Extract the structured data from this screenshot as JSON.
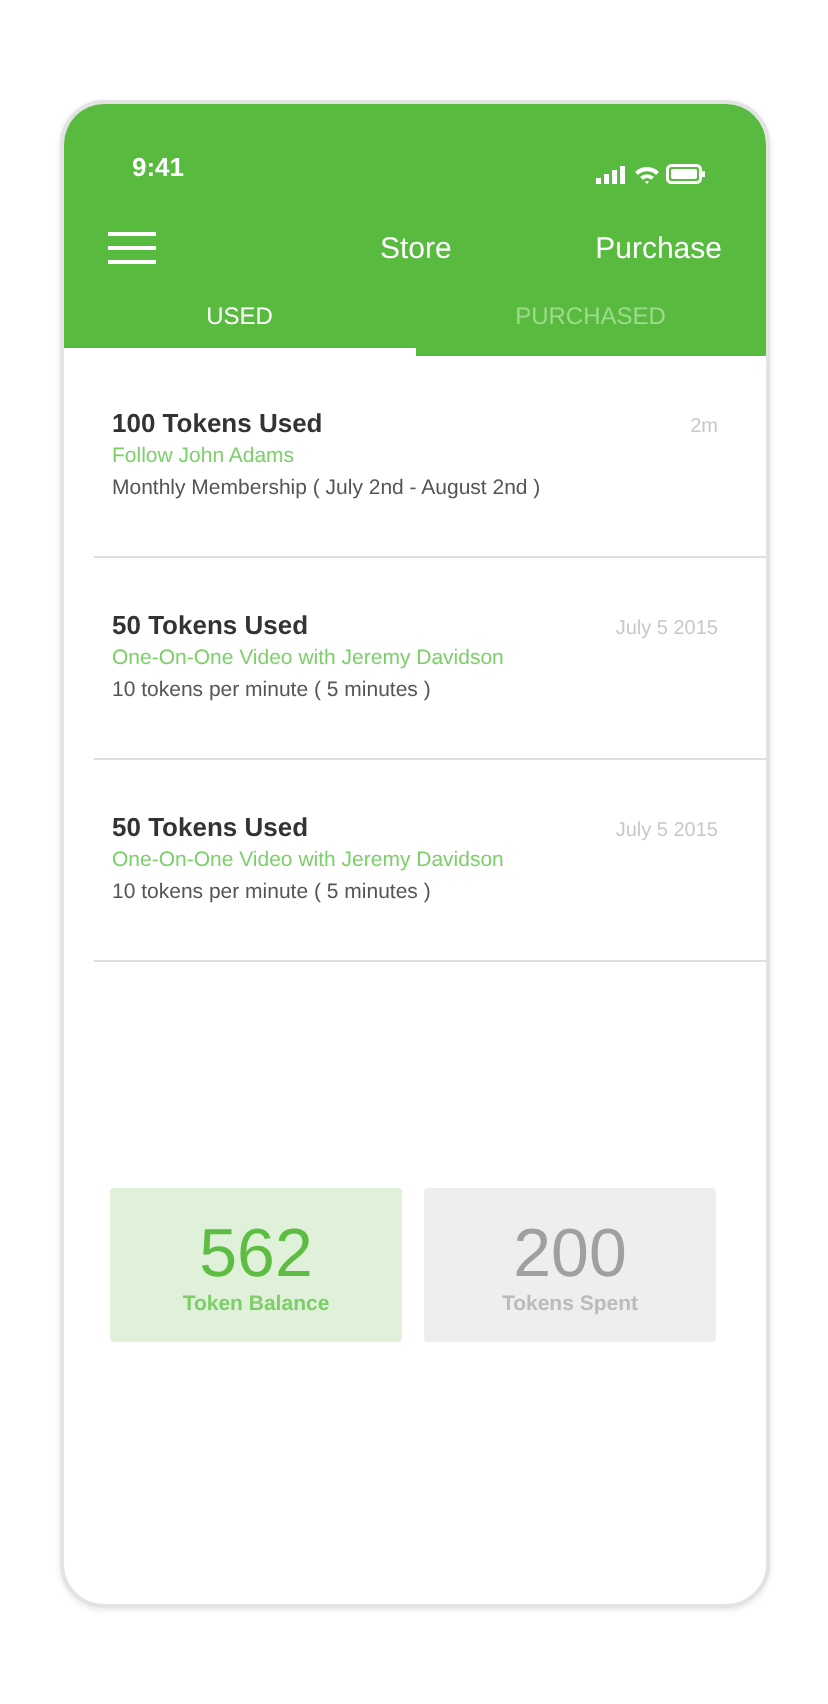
{
  "status_bar": {
    "time": "9:41"
  },
  "header": {
    "title": "Store",
    "action": "Purchase"
  },
  "tabs": [
    {
      "label": "USED",
      "selected": true
    },
    {
      "label": "PURCHASED",
      "selected": false
    }
  ],
  "transactions": [
    {
      "title": "100 Tokens Used",
      "subtitle": "Follow John Adams",
      "detail": "Monthly Membership ( July 2nd - August 2nd )",
      "time": "2m"
    },
    {
      "title": "50 Tokens Used",
      "subtitle": "One-On-One Video with Jeremy Davidson",
      "detail": "10 tokens per minute ( 5 minutes )",
      "time": "July 5 2015"
    },
    {
      "title": "50 Tokens Used",
      "subtitle": "One-On-One Video with Jeremy Davidson",
      "detail": "10 tokens per minute ( 5 minutes )",
      "time": "July 5 2015"
    }
  ],
  "stats": [
    {
      "kind": "balance",
      "value": "562",
      "label": "Token Balance"
    },
    {
      "kind": "spent",
      "value": "200",
      "label": "Tokens Spent"
    }
  ]
}
